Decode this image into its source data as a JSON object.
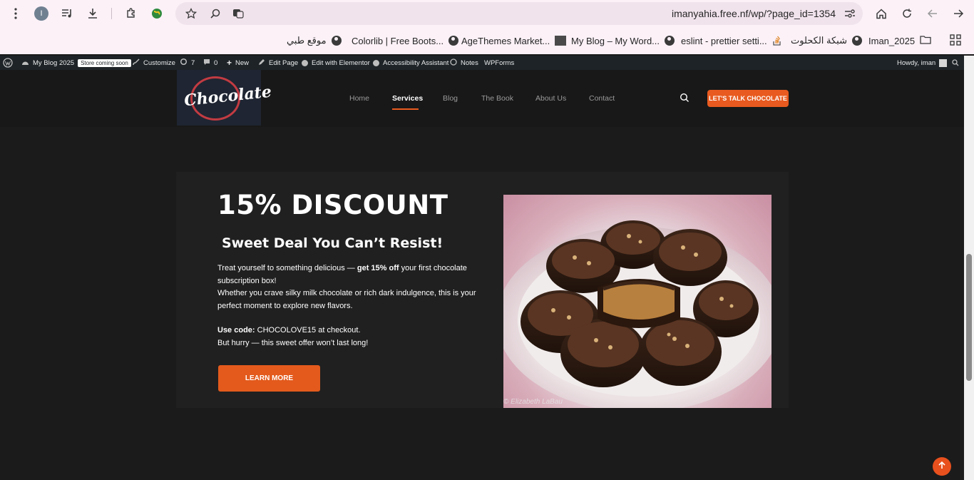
{
  "browser": {
    "url": "imanyahia.free.nf/wp/?page_id=1354",
    "profile_initial": "I",
    "bookmarks": [
      {
        "label": "موقع طبي"
      },
      {
        "label": "Colorlib | Free Boots..."
      },
      {
        "label": "AgeThemes Market..."
      },
      {
        "label": "My Blog – My Word..."
      },
      {
        "label": "eslint - prettier setti..."
      },
      {
        "label": "شبكة الكحلوت"
      },
      {
        "label": "Iman_2025"
      }
    ]
  },
  "admin_bar": {
    "site_name": "My Blog 2025",
    "store_badge": "Store coming soon",
    "customize": "Customize",
    "updates_count": "7",
    "comments_count": "0",
    "new": "New",
    "edit_page": "Edit Page",
    "elementor": "Edit with Elementor",
    "accessibility": "Accessibility Assistant",
    "notes": "Notes",
    "wpforms": "WPForms",
    "howdy": "Howdy, iman"
  },
  "header": {
    "logo_text": "Chocolate",
    "nav": [
      {
        "label": "Home"
      },
      {
        "label": "Services"
      },
      {
        "label": "Blog"
      },
      {
        "label": "The Book"
      },
      {
        "label": "About Us"
      },
      {
        "label": "Contact"
      }
    ],
    "cta": "LET'S TALK CHOCOLATE"
  },
  "promo": {
    "headline": "15% DISCOUNT",
    "subhead": "Sweet Deal You Can’t Resist!",
    "line1_pre": "Treat yourself to something delicious — ",
    "line1_bold": "get 15% off",
    "line1_post": " your first chocolate subscription box!",
    "line2": "Whether you crave silky milk chocolate or rich dark indulgence, this is your perfect moment to explore new flavors.",
    "code_label": "Use code:",
    "code_text": " CHOCOLOVE15 at checkout.",
    "hurry": "But hurry — this sweet offer won’t last long!",
    "button": "LEARN MORE",
    "photo_credit": "© Elizabeth LaBau"
  },
  "colors": {
    "accent": "#e85a1f",
    "page_bg": "#1b1b1b",
    "panel_bg": "#202020",
    "header_bg": "#181818"
  }
}
